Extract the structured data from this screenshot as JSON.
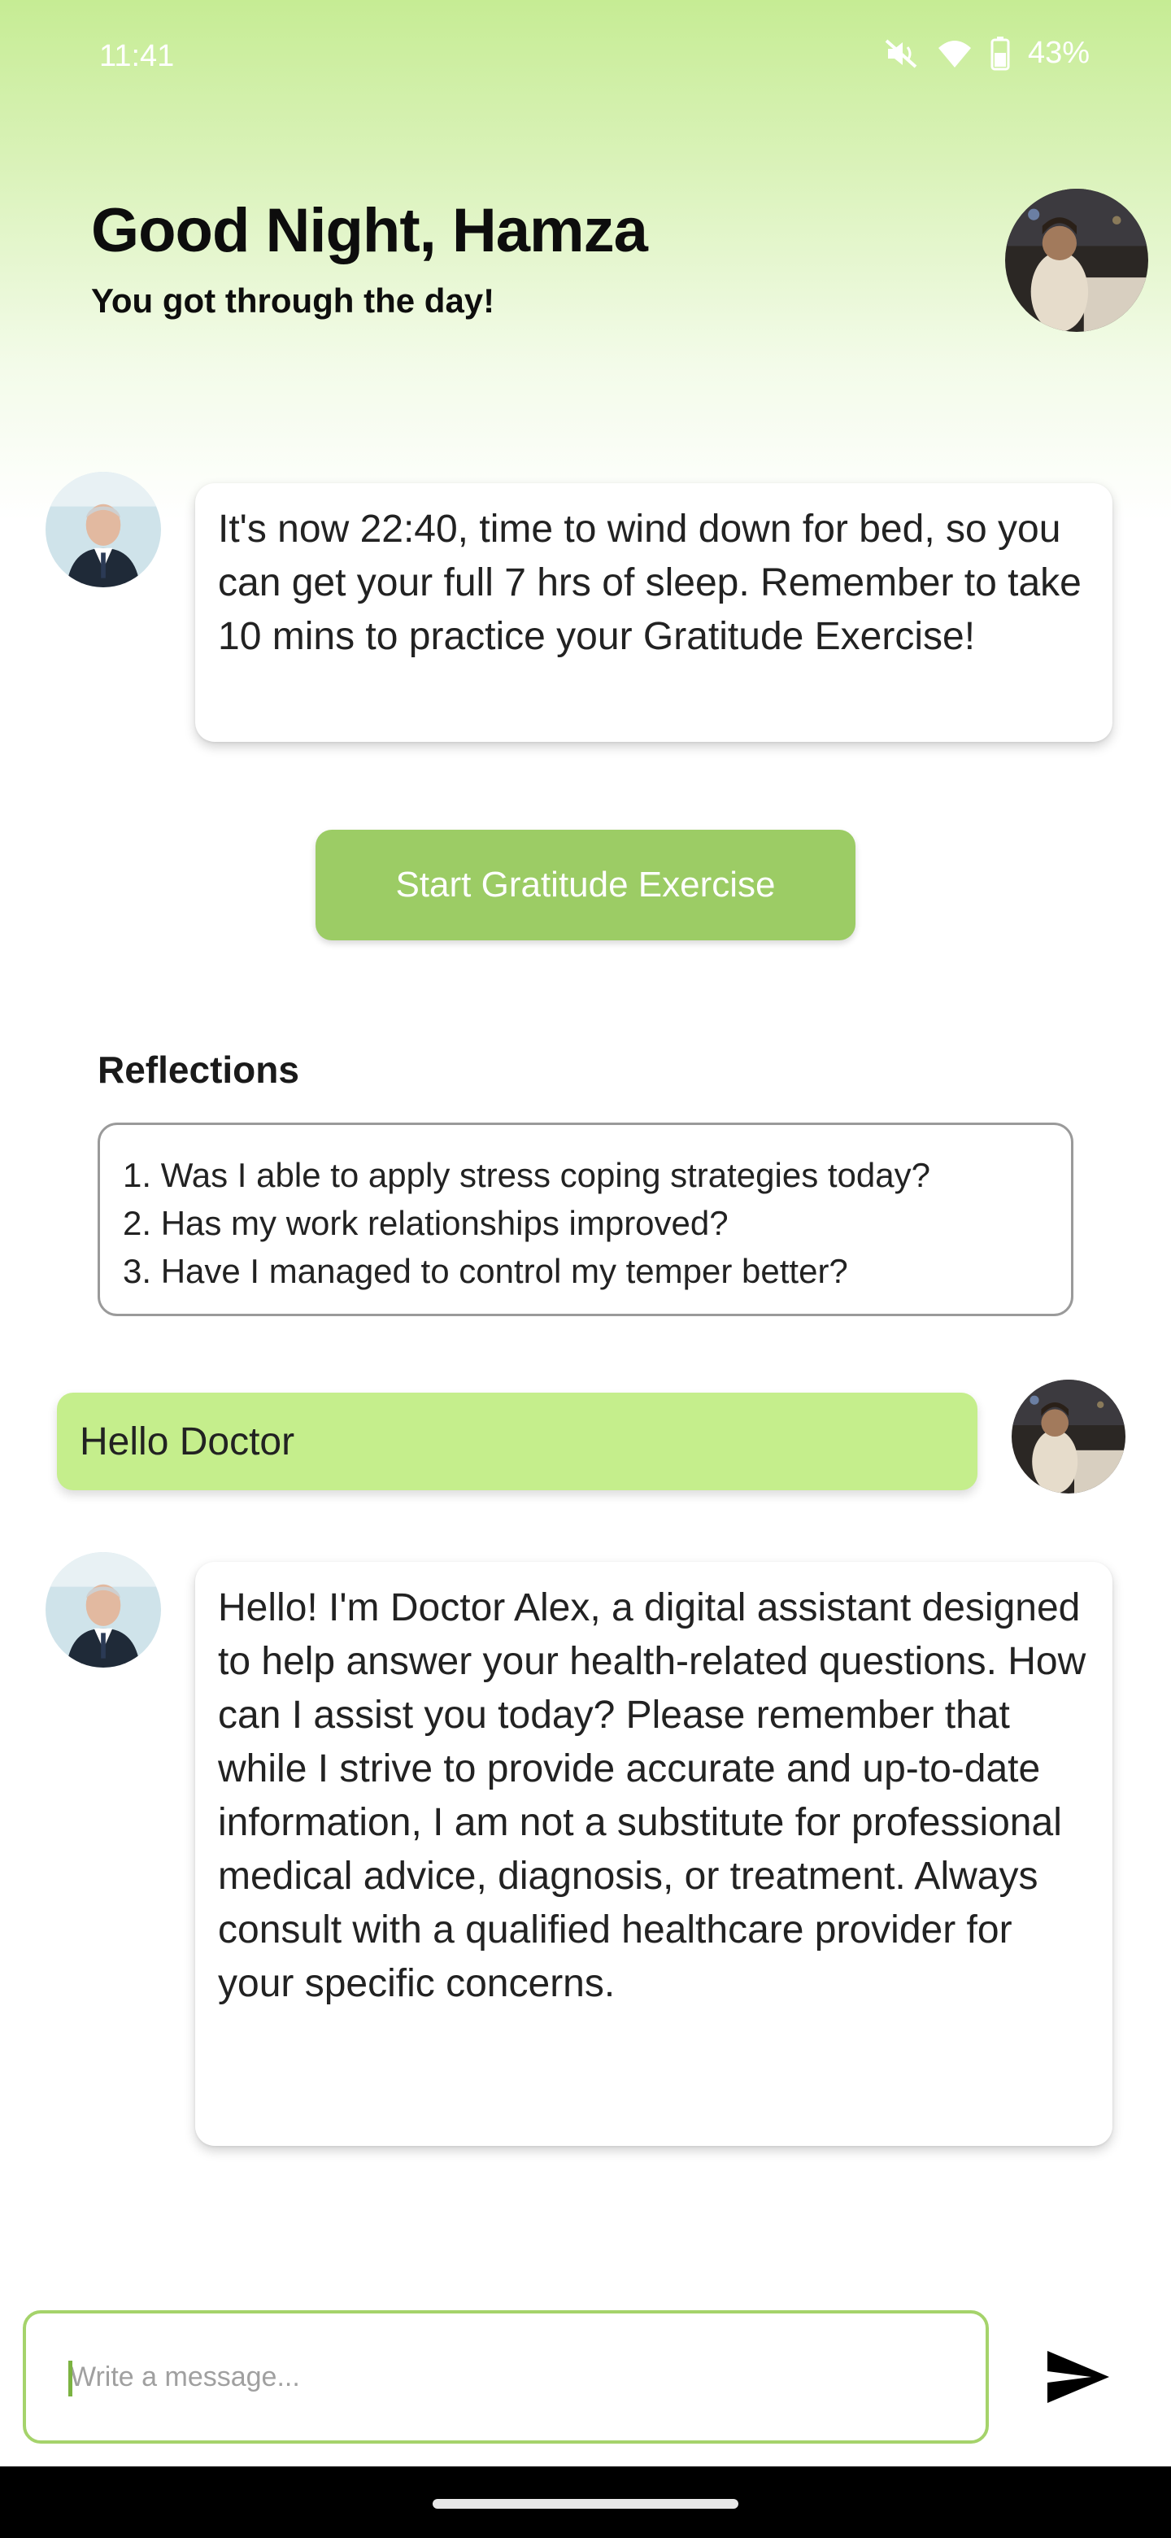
{
  "status_bar": {
    "time": "11:41",
    "battery": "43%",
    "icons": [
      "mute-icon",
      "wifi-icon",
      "battery-icon"
    ]
  },
  "header": {
    "title": "Good Night, Hamza",
    "subtitle": "You got through the day!"
  },
  "messages": {
    "bot_1": "It's now 22:40, time to wind down for bed, so you can get your full 7 hrs of sleep. Remember to take 10 mins to practice your Gratitude Exercise!",
    "user_1": "Hello Doctor",
    "bot_2": "Hello! I'm Doctor Alex, a digital assistant designed to help answer your health-related questions. How can I assist you today? Please remember that while I strive to provide accurate and up-to-date information, I am not a substitute for professional medical advice, diagnosis, or treatment. Always consult with a qualified healthcare provider for your specific concerns."
  },
  "actions": {
    "start_exercise_label": "Start Gratitude Exercise"
  },
  "reflections": {
    "title": "Reflections",
    "items": [
      "1. Was I able to apply stress coping strategies today?",
      "2. Has my work relationships improved?",
      "3. Have I managed to control my temper better?"
    ]
  },
  "composer": {
    "placeholder": "Write a message...",
    "value": ""
  },
  "colors": {
    "accent_green": "#9ccc65",
    "user_bubble": "#c5ee8c",
    "header_gradient_top": "#c6ec94"
  }
}
